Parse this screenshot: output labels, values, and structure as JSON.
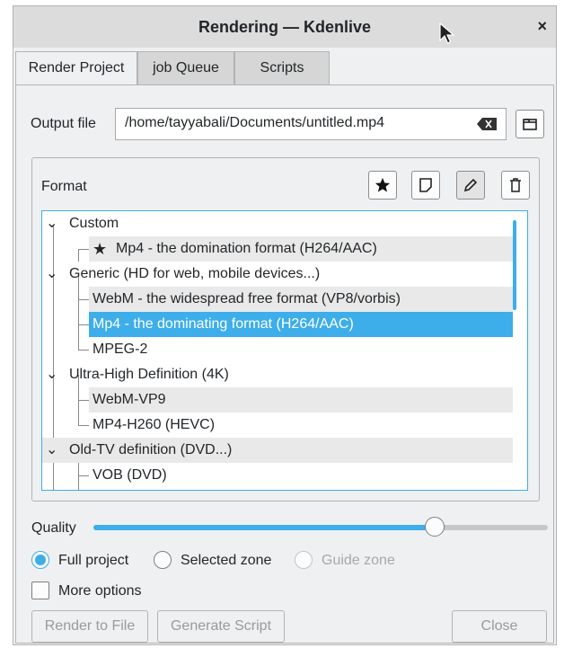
{
  "window": {
    "title": "Rendering — Kdenlive",
    "close_glyph": "×"
  },
  "tabs": [
    {
      "label": "Render Project",
      "active": true
    },
    {
      "label": "job Queue",
      "active": false
    },
    {
      "label": "Scripts",
      "active": false
    }
  ],
  "output": {
    "label": "Output file",
    "value": "/home/tayyabali/Documents/untitled.mp4"
  },
  "format": {
    "label": "Format",
    "toolbar_icons": [
      "star-icon",
      "new-document-icon",
      "edit-pencil-icon",
      "trash-icon"
    ],
    "tree": [
      {
        "label": "Custom",
        "level": 0,
        "expanded": true
      },
      {
        "label": "Mp4 - the domination format (H264/AAC)",
        "level": 1,
        "starred": true
      },
      {
        "label": "Generic (HD for web, mobile devices...)",
        "level": 0,
        "expanded": true
      },
      {
        "label": "WebM - the widespread free format (VP8/vorbis)",
        "level": 1
      },
      {
        "label": "Mp4 - the dominating format (H264/AAC)",
        "level": 1,
        "selected": true
      },
      {
        "label": "MPEG-2",
        "level": 1
      },
      {
        "label": "Ultra-High Definition (4K)",
        "level": 0,
        "expanded": true
      },
      {
        "label": "WebM-VP9",
        "level": 1
      },
      {
        "label": "MP4-H260 (HEVC)",
        "level": 1
      },
      {
        "label": "Old-TV definition (DVD...)",
        "level": 0,
        "expanded": true
      },
      {
        "label": "VOB (DVD)",
        "level": 1
      }
    ]
  },
  "quality": {
    "label": "Quality",
    "value_fraction": 0.75
  },
  "zone": {
    "options": [
      {
        "label": "Full project",
        "checked": true,
        "enabled": true
      },
      {
        "label": "Selected zone",
        "checked": false,
        "enabled": true
      },
      {
        "label": "Guide zone",
        "checked": false,
        "enabled": false
      }
    ]
  },
  "more_options": {
    "label": "More options",
    "checked": false
  },
  "buttons": {
    "render": "Render to File",
    "script": "Generate Script",
    "close": "Close"
  },
  "colors": {
    "accent": "#3daee9",
    "window_bg": "#eff0f1",
    "titlebar_bg": "#dcdcdc"
  }
}
